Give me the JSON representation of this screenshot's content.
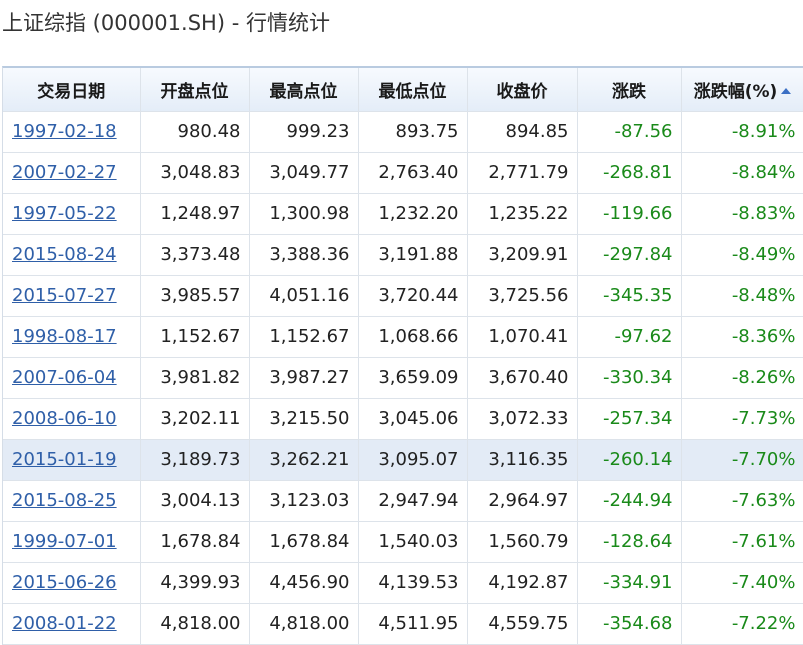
{
  "page": {
    "title": "上证综指 (000001.SH) - 行情统计"
  },
  "table": {
    "columns": [
      "交易日期",
      "开盘点位",
      "最高点位",
      "最低点位",
      "收盘价",
      "涨跌",
      "涨跌幅(%)"
    ],
    "sort_column": "涨跌幅(%)",
    "highlight_row": 8,
    "rows": [
      [
        "1997-02-18",
        "980.48",
        "999.23",
        "893.75",
        "894.85",
        "-87.56",
        "-8.91%"
      ],
      [
        "2007-02-27",
        "3,048.83",
        "3,049.77",
        "2,763.40",
        "2,771.79",
        "-268.81",
        "-8.84%"
      ],
      [
        "1997-05-22",
        "1,248.97",
        "1,300.98",
        "1,232.20",
        "1,235.22",
        "-119.66",
        "-8.83%"
      ],
      [
        "2015-08-24",
        "3,373.48",
        "3,388.36",
        "3,191.88",
        "3,209.91",
        "-297.84",
        "-8.49%"
      ],
      [
        "2015-07-27",
        "3,985.57",
        "4,051.16",
        "3,720.44",
        "3,725.56",
        "-345.35",
        "-8.48%"
      ],
      [
        "1998-08-17",
        "1,152.67",
        "1,152.67",
        "1,068.66",
        "1,070.41",
        "-97.62",
        "-8.36%"
      ],
      [
        "2007-06-04",
        "3,981.82",
        "3,987.27",
        "3,659.09",
        "3,670.40",
        "-330.34",
        "-8.26%"
      ],
      [
        "2008-06-10",
        "3,202.11",
        "3,215.50",
        "3,045.06",
        "3,072.33",
        "-257.34",
        "-7.73%"
      ],
      [
        "2015-01-19",
        "3,189.73",
        "3,262.21",
        "3,095.07",
        "3,116.35",
        "-260.14",
        "-7.70%"
      ],
      [
        "2015-08-25",
        "3,004.13",
        "3,123.03",
        "2,947.94",
        "2,964.97",
        "-244.94",
        "-7.63%"
      ],
      [
        "1999-07-01",
        "1,678.84",
        "1,678.84",
        "1,540.03",
        "1,560.79",
        "-128.64",
        "-7.61%"
      ],
      [
        "2015-06-26",
        "4,399.93",
        "4,456.90",
        "4,139.53",
        "4,192.87",
        "-334.91",
        "-7.40%"
      ],
      [
        "2008-01-22",
        "4,818.00",
        "4,818.00",
        "4,511.95",
        "4,559.75",
        "-354.68",
        "-7.22%"
      ]
    ]
  },
  "colors": {
    "link": "#2f5fa8",
    "negative": "#1a8a1a",
    "highlight_bg": "#e3ebf6",
    "sort_icon": "#3b6fc4"
  },
  "icons": {
    "sort": "sort-ascending-icon"
  }
}
